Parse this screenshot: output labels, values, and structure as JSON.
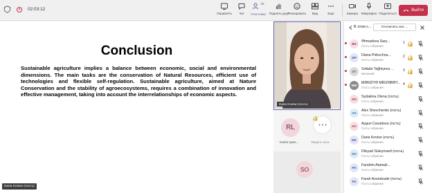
{
  "topbar": {
    "timer": "02:03:12",
    "tools": [
      {
        "label": "Управлять",
        "icon": "manage-icon"
      },
      {
        "label": "Чат",
        "icon": "chat-icon"
      },
      {
        "label": "Участники",
        "icon": "people-icon",
        "count": "25"
      },
      {
        "label": "Поднять руку",
        "icon": "raise-hand-icon"
      },
      {
        "label": "Реагировать",
        "icon": "react-icon"
      },
      {
        "label": "Вид",
        "icon": "view-icon"
      },
      {
        "label": "Еще",
        "icon": "more-icon"
      },
      {
        "label": "Камера",
        "icon": "camera-icon"
      },
      {
        "label": "Микрофон",
        "icon": "mic-icon"
      },
      {
        "label": "Поделиться",
        "icon": "share-icon"
      }
    ],
    "leave_label": "Выйти",
    "accent": "#6264a7",
    "leave_color": "#c4314b"
  },
  "slide": {
    "title": "Conclusion",
    "body": "Sustainable agriculture implies a balance between economic, social and environmental dimensions. The main tasks are the conservation of Natural Resources, efficient use of technologies and flexible self-regulation. Sustainable agriculture, aimed at Nature Conservation and the stability of agroecosystems, requires a combination of innovation and effective management, taking into account the interrelationships of economic aspects.",
    "presenter": "Daria Kovtun (гость)"
  },
  "video": {
    "name_tag": "Daria Kovtun (гость)",
    "tile_rl": {
      "initials": "RL",
      "name": "Kamiz Şam..."
    },
    "more_label": "Увидеть всех",
    "tile_so": {
      "initials": "SO"
    }
  },
  "panel": {
    "title": "В этом с...",
    "mute_all": "Отключить все ...",
    "participants": [
      {
        "initials": "ƏS",
        "name": "Əhmadova Sary...",
        "role": "Гость собрания",
        "hand": "1",
        "av_bg": "#f8dde3",
        "av_fg": "#8a2b47"
      },
      {
        "initials": "DP",
        "name": "Diana Pidruchna...",
        "role": "Гость собрания",
        "hand": "2",
        "av_bg": "#e2e5f7",
        "av_fg": "#3a4ba0"
      },
      {
        "initials": "ST",
        "name": "Səfadə Tağhiyeva ...",
        "role": "Внешний",
        "hand": "3",
        "av_bg": "#d9d9d9",
        "av_fg": "#555555"
      },
      {
        "initials": "MM",
        "name": "MƏRZİYƏ MİRZƏBƏY...",
        "role": "Гость собрания",
        "hand": "4",
        "av_bg": "#8a8a8a",
        "av_fg": "#ffffff"
      },
      {
        "initials": "SO",
        "name": "Sydakina Olena (гость)",
        "role": "Гость собрания",
        "hand": "",
        "av_bg": "#f8dde3",
        "av_fg": "#8a2b47"
      },
      {
        "initials": "AS",
        "name": "Alex Shevchenko (гость)",
        "role": "Гость собрания",
        "hand": "",
        "av_bg": "#dcecf9",
        "av_fg": "#2b6aa0"
      },
      {
        "initials": "AC",
        "name": "Aygun Cavadova (гость)",
        "role": "Гость собрания",
        "hand": "",
        "av_bg": "#f8dde3",
        "av_fg": "#8a2b47"
      },
      {
        "initials": "DK",
        "name": "Daria Kovtun (гость)",
        "role": "Гость собрания",
        "hand": "",
        "av_bg": "#e2e5f7",
        "av_fg": "#3a4ba0"
      },
      {
        "initials": "DS",
        "name": "Dilsyad Süleymanli (гость)",
        "role": "Гость собрания",
        "hand": "",
        "av_bg": "#dcecf9",
        "av_fg": "#2b6aa0"
      },
      {
        "initials": "FA",
        "name": "Farahim Atamali...",
        "role": "Гость собрания",
        "hand": "",
        "av_bg": "#e2e5f7",
        "av_fg": "#3a4ba0"
      },
      {
        "initials": "FA",
        "name": "Farah Axundzade (гость)",
        "role": "Гость собрания",
        "hand": "",
        "av_bg": "#e2e5f7",
        "av_fg": "#3a4ba0"
      }
    ]
  }
}
